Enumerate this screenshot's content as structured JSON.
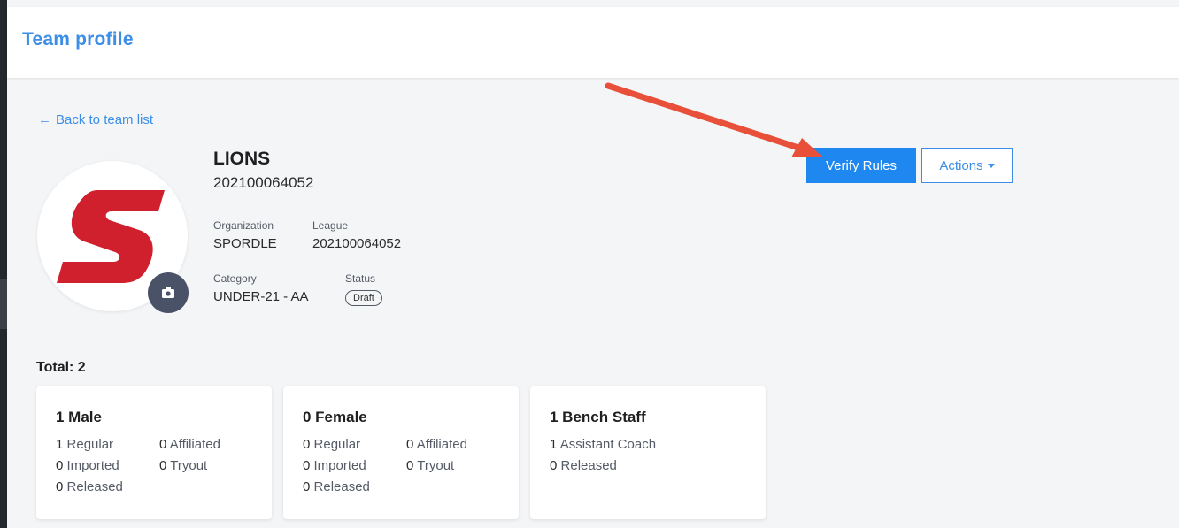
{
  "header": {
    "title": "Team profile"
  },
  "nav": {
    "back_label": "Back to team list",
    "back_icon": "arrow-left-icon"
  },
  "team": {
    "name": "LIONS",
    "number": "202100064052",
    "organization_label": "Organization",
    "organization": "SPORDLE",
    "league_label": "League",
    "league": "202100064052",
    "category_label": "Category",
    "category": "UNDER-21 - AA",
    "status_label": "Status",
    "status": "Draft"
  },
  "actions": {
    "verify_label": "Verify Rules",
    "actions_label": "Actions"
  },
  "summary": {
    "total_label": "Total: 2",
    "male": {
      "title": "1 Male",
      "regular_n": "1",
      "regular": "Regular",
      "affiliated_n": "0",
      "affiliated": "Affiliated",
      "imported_n": "0",
      "imported": "Imported",
      "tryout_n": "0",
      "tryout": "Tryout",
      "released_n": "0",
      "released": "Released"
    },
    "female": {
      "title": "0 Female",
      "regular_n": "0",
      "regular": "Regular",
      "affiliated_n": "0",
      "affiliated": "Affiliated",
      "imported_n": "0",
      "imported": "Imported",
      "tryout_n": "0",
      "tryout": "Tryout",
      "released_n": "0",
      "released": "Released"
    },
    "staff": {
      "title": "1 Bench Staff",
      "coach_n": "1",
      "coach": "Assistant Coach",
      "released_n": "0",
      "released": "Released"
    }
  },
  "colors": {
    "accent": "#3c8ee6",
    "primary_button": "#1e88f0",
    "logo_red": "#d0202e",
    "annotation_arrow": "#e8503a"
  }
}
